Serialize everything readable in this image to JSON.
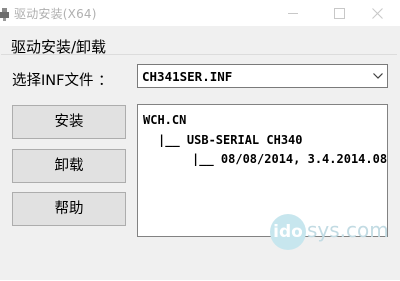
{
  "window": {
    "title": "驱动安装(X64)",
    "icon": "usb-plug-icon"
  },
  "group": {
    "title": "驱动安装/卸载"
  },
  "inf": {
    "label": "选择INF文件 ：",
    "selected": "CH341SER.INF"
  },
  "buttons": {
    "install": "安装",
    "uninstall": "卸载",
    "help": "帮助"
  },
  "info": {
    "lines": [
      "WCH.CN",
      "|__ USB-SERIAL CH340",
      "|__ 08/08/2014, 3.4.2014.08"
    ]
  },
  "watermark": {
    "badge": "ido",
    "text": "sys.com"
  },
  "colors": {
    "window_bg": "#f0f0f0",
    "button_bg": "#e1e1e1",
    "title_inactive": "#b0b0b0"
  }
}
